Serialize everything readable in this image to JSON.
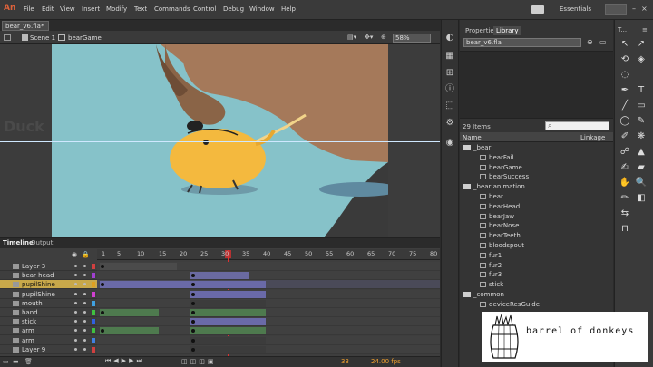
{
  "app": {
    "logo": "An",
    "menu": [
      "File",
      "Edit",
      "View",
      "Insert",
      "Modify",
      "Text",
      "Commands",
      "Control",
      "Debug",
      "Window",
      "Help"
    ],
    "workspace": "Essentials",
    "accent": "#e0623a"
  },
  "document": {
    "tab": "bear_v6.fla*",
    "scene": "Scene 1",
    "symbol": "bearGame",
    "zoom": "58%"
  },
  "library": {
    "tabs": [
      "Properties",
      "Library"
    ],
    "file_select": "bear_v6.fla",
    "items_count": "29 Items",
    "columns": [
      "Name",
      "Linkage"
    ],
    "rows": [
      {
        "type": "folder",
        "label": "_bear",
        "indent": 0
      },
      {
        "type": "symbol",
        "label": "bearFail",
        "indent": 1
      },
      {
        "type": "symbol",
        "label": "bearGame",
        "indent": 1
      },
      {
        "type": "symbol",
        "label": "bearSuccess",
        "indent": 1
      },
      {
        "type": "folder",
        "label": "_bear animation",
        "indent": 0
      },
      {
        "type": "symbol",
        "label": "bear",
        "indent": 1
      },
      {
        "type": "symbol",
        "label": "bearHead",
        "indent": 1
      },
      {
        "type": "symbol",
        "label": "bearJaw",
        "indent": 1
      },
      {
        "type": "symbol",
        "label": "bearNose",
        "indent": 1
      },
      {
        "type": "symbol",
        "label": "bearTeeth",
        "indent": 1
      },
      {
        "type": "symbol",
        "label": "bloodspout",
        "indent": 1
      },
      {
        "type": "symbol",
        "label": "fur1",
        "indent": 1
      },
      {
        "type": "symbol",
        "label": "fur2",
        "indent": 1
      },
      {
        "type": "symbol",
        "label": "fur3",
        "indent": 1
      },
      {
        "type": "symbol",
        "label": "stick",
        "indent": 1
      },
      {
        "type": "folder",
        "label": "_common",
        "indent": 0
      },
      {
        "type": "symbol",
        "label": "deviceResGuide",
        "indent": 1
      }
    ]
  },
  "stage": {
    "ghost_text": "Duck",
    "background": "#86c2c9"
  },
  "timeline": {
    "tabs": [
      "Timeline",
      "Output"
    ],
    "frame_ticks": [
      "1",
      "5",
      "10",
      "15",
      "20",
      "25",
      "30",
      "35",
      "40",
      "45",
      "50",
      "55",
      "60",
      "65",
      "70",
      "75",
      "80"
    ],
    "frame_label": "bearMiss",
    "current_frame": "33",
    "fps": "24.00 fps",
    "layers": [
      {
        "name": "Layer 3",
        "color": "#d04040"
      },
      {
        "name": "bear head",
        "color": "#a040d0"
      },
      {
        "name": "pupilShine",
        "color": "#e0a020",
        "selected": true
      },
      {
        "name": "pupilShine",
        "color": "#d040d0"
      },
      {
        "name": "mouth",
        "color": "#40a0e0"
      },
      {
        "name": "hand",
        "color": "#40c040"
      },
      {
        "name": "stick",
        "color": "#3060e0"
      },
      {
        "name": "arm",
        "color": "#40c040"
      },
      {
        "name": "arm",
        "color": "#4080e0"
      },
      {
        "name": "Layer 9",
        "color": "#d04040"
      }
    ]
  },
  "watermark": {
    "text": "barrel of donkeys"
  }
}
